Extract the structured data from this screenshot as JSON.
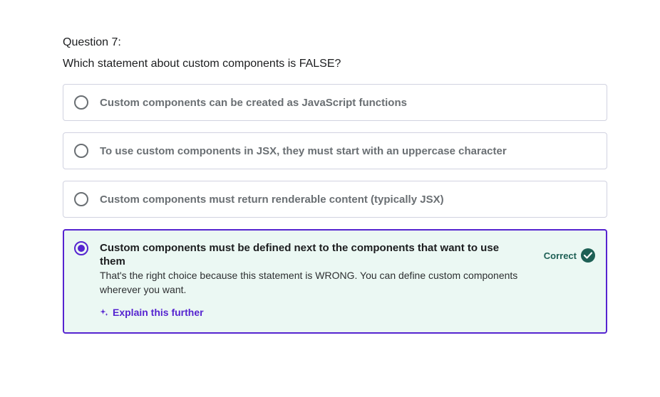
{
  "question": {
    "number_label": "Question 7:",
    "text": "Which statement about custom components is FALSE?"
  },
  "options": [
    {
      "text": "Custom components can be created as JavaScript functions"
    },
    {
      "text": "To use custom components in JSX, they must start with an uppercase character"
    },
    {
      "text": "Custom components must return renderable content (typically JSX)"
    },
    {
      "text": "Custom components must be defined next to the components that want to use them",
      "explanation": "That's the right choice because this statement is WRONG. You can define custom components wherever you want.",
      "explain_link": "Explain this further",
      "status": "Correct"
    }
  ],
  "colors": {
    "selected_border": "#5624d0",
    "selected_background": "#ebf8f3",
    "correct_green": "#1e6055"
  },
  "icons": {
    "explain": "sparkle-icon",
    "status": "check-circle-icon"
  }
}
